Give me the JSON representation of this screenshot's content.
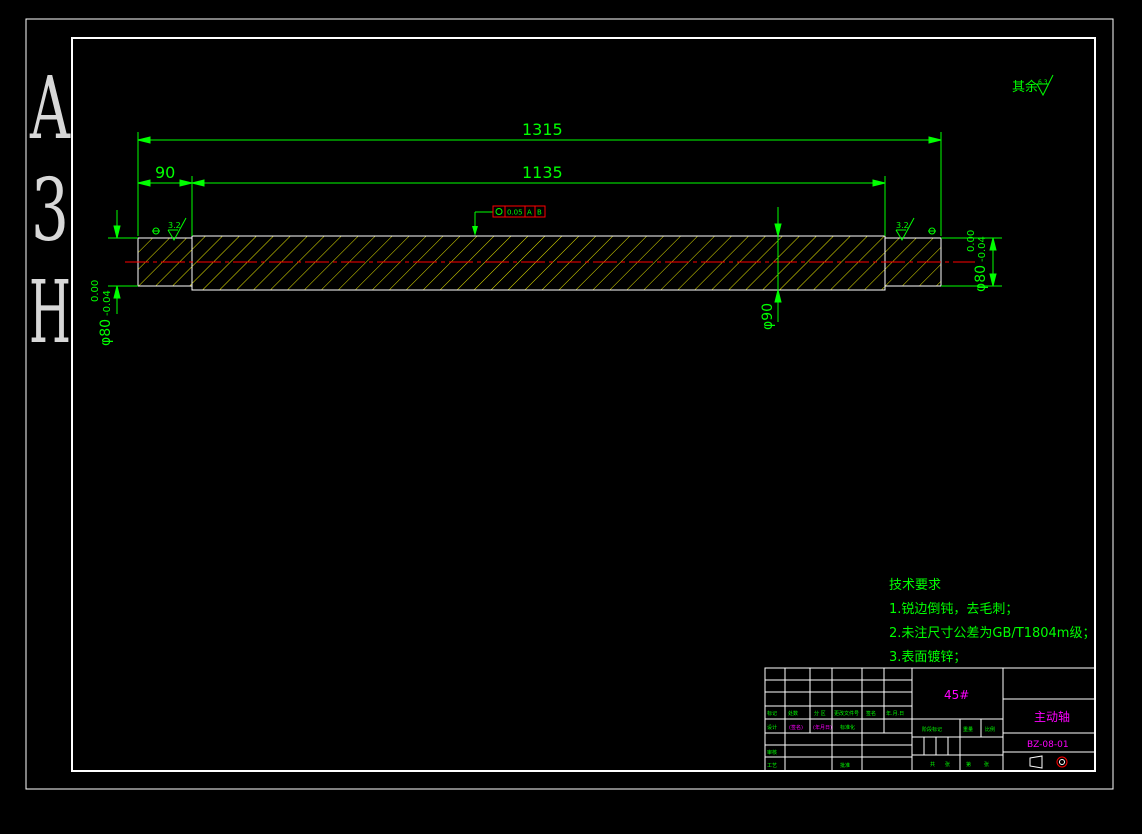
{
  "sheet": {
    "size_letters": [
      "A",
      "3",
      "H"
    ]
  },
  "surface_note": {
    "text": "其余",
    "symbol_value": "6.3"
  },
  "dimensions": {
    "overall_length": "1315",
    "left_step_length": "90",
    "middle_length": "1135",
    "right_diameter": "φ80",
    "right_tol_upper": "0.00",
    "right_tol_lower": "-0.04",
    "left_diameter": "φ80",
    "left_tol_upper": "0.00",
    "left_tol_lower": "-0.04",
    "middle_diameter": "φ90"
  },
  "roughness": {
    "left": "3.2",
    "right": "3.2"
  },
  "tolerance_frame": {
    "value": "0.05",
    "datum": "A",
    "datum2": "B"
  },
  "technical_requirements": {
    "title": "技术要求",
    "items": [
      "1.锐边倒钝，去毛刺；",
      "2.未注尺寸公差为GB/T1804m级；",
      "3.表面镀锌；"
    ]
  },
  "title_block": {
    "material": "45#",
    "part_name": "主动轴",
    "drawing_number": "BZ-08-01",
    "cells": {
      "mark": "标记",
      "count": "处数",
      "zone": "分 区",
      "change_doc": "更改文件号",
      "sign": "签名",
      "date": "年.月.日",
      "design": "设计",
      "sign_name": "(签名)",
      "date2": "(年月日)",
      "standardization": "标准化",
      "stage_mark": "阶段标记",
      "weight": "重量",
      "scale": "比例",
      "review": "审核",
      "process": "工艺",
      "approve": "批准",
      "sheets_total": "共",
      "sheet_no": "张",
      "page": "第",
      "page_unit": "张"
    }
  },
  "colors": {
    "background": "#000000",
    "frame": "#ffffff",
    "geometry": "#ffffff",
    "hatch": "#e6e600",
    "dimension": "#00ff00",
    "centerline": "#ff0000",
    "title_text": "#ff00ff"
  }
}
